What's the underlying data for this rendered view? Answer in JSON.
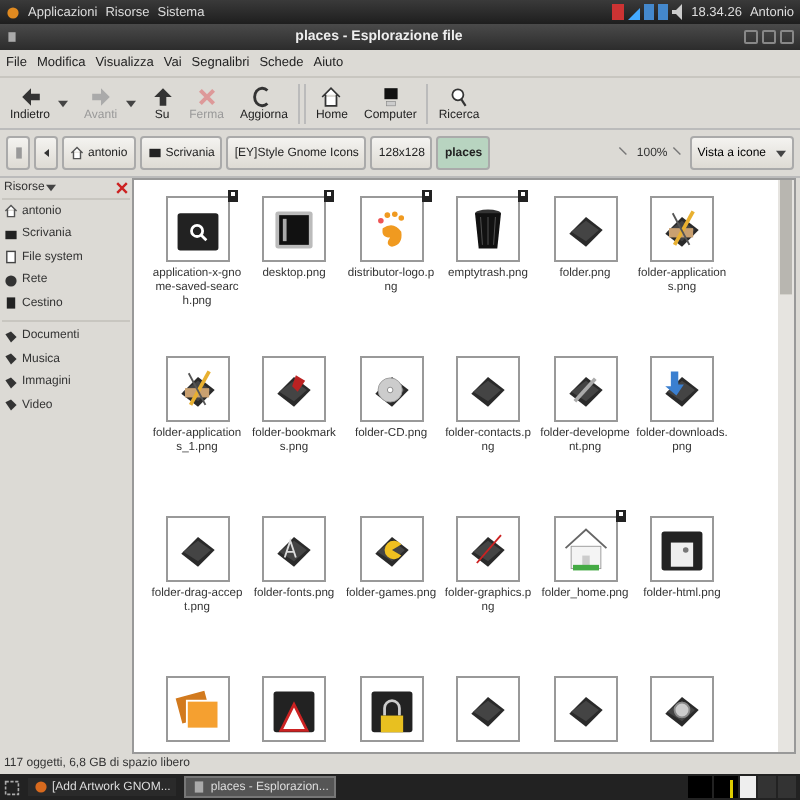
{
  "top_panel": {
    "menus": [
      "Applicazioni",
      "Risorse",
      "Sistema"
    ],
    "clock": "18.34.26",
    "user": "Antonio"
  },
  "window": {
    "title": "places - Esplorazione file"
  },
  "menu_bar": [
    "File",
    "Modifica",
    "Visualizza",
    "Vai",
    "Segnalibri",
    "Schede",
    "Aiuto"
  ],
  "toolbar": [
    {
      "label": "Indietro",
      "kind": "back",
      "disabled": false,
      "dropdown": true
    },
    {
      "label": "Avanti",
      "kind": "forward",
      "disabled": true,
      "dropdown": true
    },
    {
      "label": "Su",
      "kind": "up",
      "disabled": false,
      "dropdown": false
    },
    {
      "label": "Ferma",
      "kind": "stop",
      "disabled": true,
      "dropdown": false
    },
    {
      "label": "Aggiorna",
      "kind": "reload",
      "disabled": false,
      "dropdown": false
    },
    {
      "label": "Home",
      "kind": "home",
      "disabled": false,
      "dropdown": false
    },
    {
      "label": "Computer",
      "kind": "computer",
      "disabled": false,
      "dropdown": false
    },
    {
      "label": "Ricerca",
      "kind": "search",
      "disabled": false,
      "dropdown": false
    }
  ],
  "path_bar": {
    "crumbs": [
      {
        "label": "antonio",
        "kind": "home",
        "selected": false
      },
      {
        "label": "Scrivania",
        "kind": "desktop",
        "selected": false
      },
      {
        "label": "[EY]Style Gnome Icons",
        "kind": "plain",
        "selected": false
      },
      {
        "label": "128x128",
        "kind": "plain",
        "selected": false
      },
      {
        "label": "places",
        "kind": "plain",
        "selected": true
      }
    ],
    "zoom": "100%",
    "view": "Vista a icone"
  },
  "sidebar": {
    "title": "Risorse",
    "groups": [
      [
        {
          "label": "antonio",
          "kind": "home"
        },
        {
          "label": "Scrivania",
          "kind": "desktop"
        },
        {
          "label": "File system",
          "kind": "drive"
        },
        {
          "label": "Rete",
          "kind": "network"
        },
        {
          "label": "Cestino",
          "kind": "trash"
        }
      ],
      [
        {
          "label": "Documenti",
          "kind": "bookmark"
        },
        {
          "label": "Musica",
          "kind": "bookmark"
        },
        {
          "label": "Immagini",
          "kind": "bookmark"
        },
        {
          "label": "Video",
          "kind": "bookmark"
        }
      ]
    ]
  },
  "files": [
    {
      "name": "application-x-gnome-saved-search.png",
      "kind": "search-folder",
      "emblem": true
    },
    {
      "name": "desktop.png",
      "kind": "desktop",
      "emblem": true
    },
    {
      "name": "distributor-logo.png",
      "kind": "foot",
      "emblem": true
    },
    {
      "name": "emptytrash.png",
      "kind": "trash",
      "emblem": true
    },
    {
      "name": "folder.png",
      "kind": "folder",
      "emblem": false
    },
    {
      "name": "folder-applications.png",
      "kind": "tools",
      "emblem": false
    },
    {
      "name": "folder-applications_1.png",
      "kind": "tools",
      "emblem": false
    },
    {
      "name": "folder-bookmarks.png",
      "kind": "bookmark",
      "emblem": false
    },
    {
      "name": "folder-CD.png",
      "kind": "disc",
      "emblem": false
    },
    {
      "name": "folder-contacts.png",
      "kind": "folder",
      "emblem": false
    },
    {
      "name": "folder-development.png",
      "kind": "wrench",
      "emblem": false
    },
    {
      "name": "folder-downloads.png",
      "kind": "download",
      "emblem": false
    },
    {
      "name": "folder-drag-accept.png",
      "kind": "folder",
      "emblem": false
    },
    {
      "name": "folder-fonts.png",
      "kind": "fonts",
      "emblem": false
    },
    {
      "name": "folder-games.png",
      "kind": "games",
      "emblem": false
    },
    {
      "name": "folder-graphics.png",
      "kind": "brush",
      "emblem": false
    },
    {
      "name": "folder_home.png",
      "kind": "house",
      "emblem": true
    },
    {
      "name": "folder-html.png",
      "kind": "html",
      "emblem": false
    },
    {
      "kind": "photo",
      "emblem": false
    },
    {
      "kind": "warning",
      "emblem": false
    },
    {
      "kind": "lock",
      "emblem": false
    },
    {
      "kind": "folder",
      "emblem": false
    },
    {
      "kind": "folder",
      "emblem": false
    },
    {
      "kind": "camera",
      "emblem": false
    }
  ],
  "status_bar": "117 oggetti, 6,8 GB di spazio libero",
  "taskbar": [
    {
      "label": "[Add Artwork GNOM...",
      "kind": "browser",
      "selected": false
    },
    {
      "label": "places - Esplorazion...",
      "kind": "files",
      "selected": true
    }
  ]
}
